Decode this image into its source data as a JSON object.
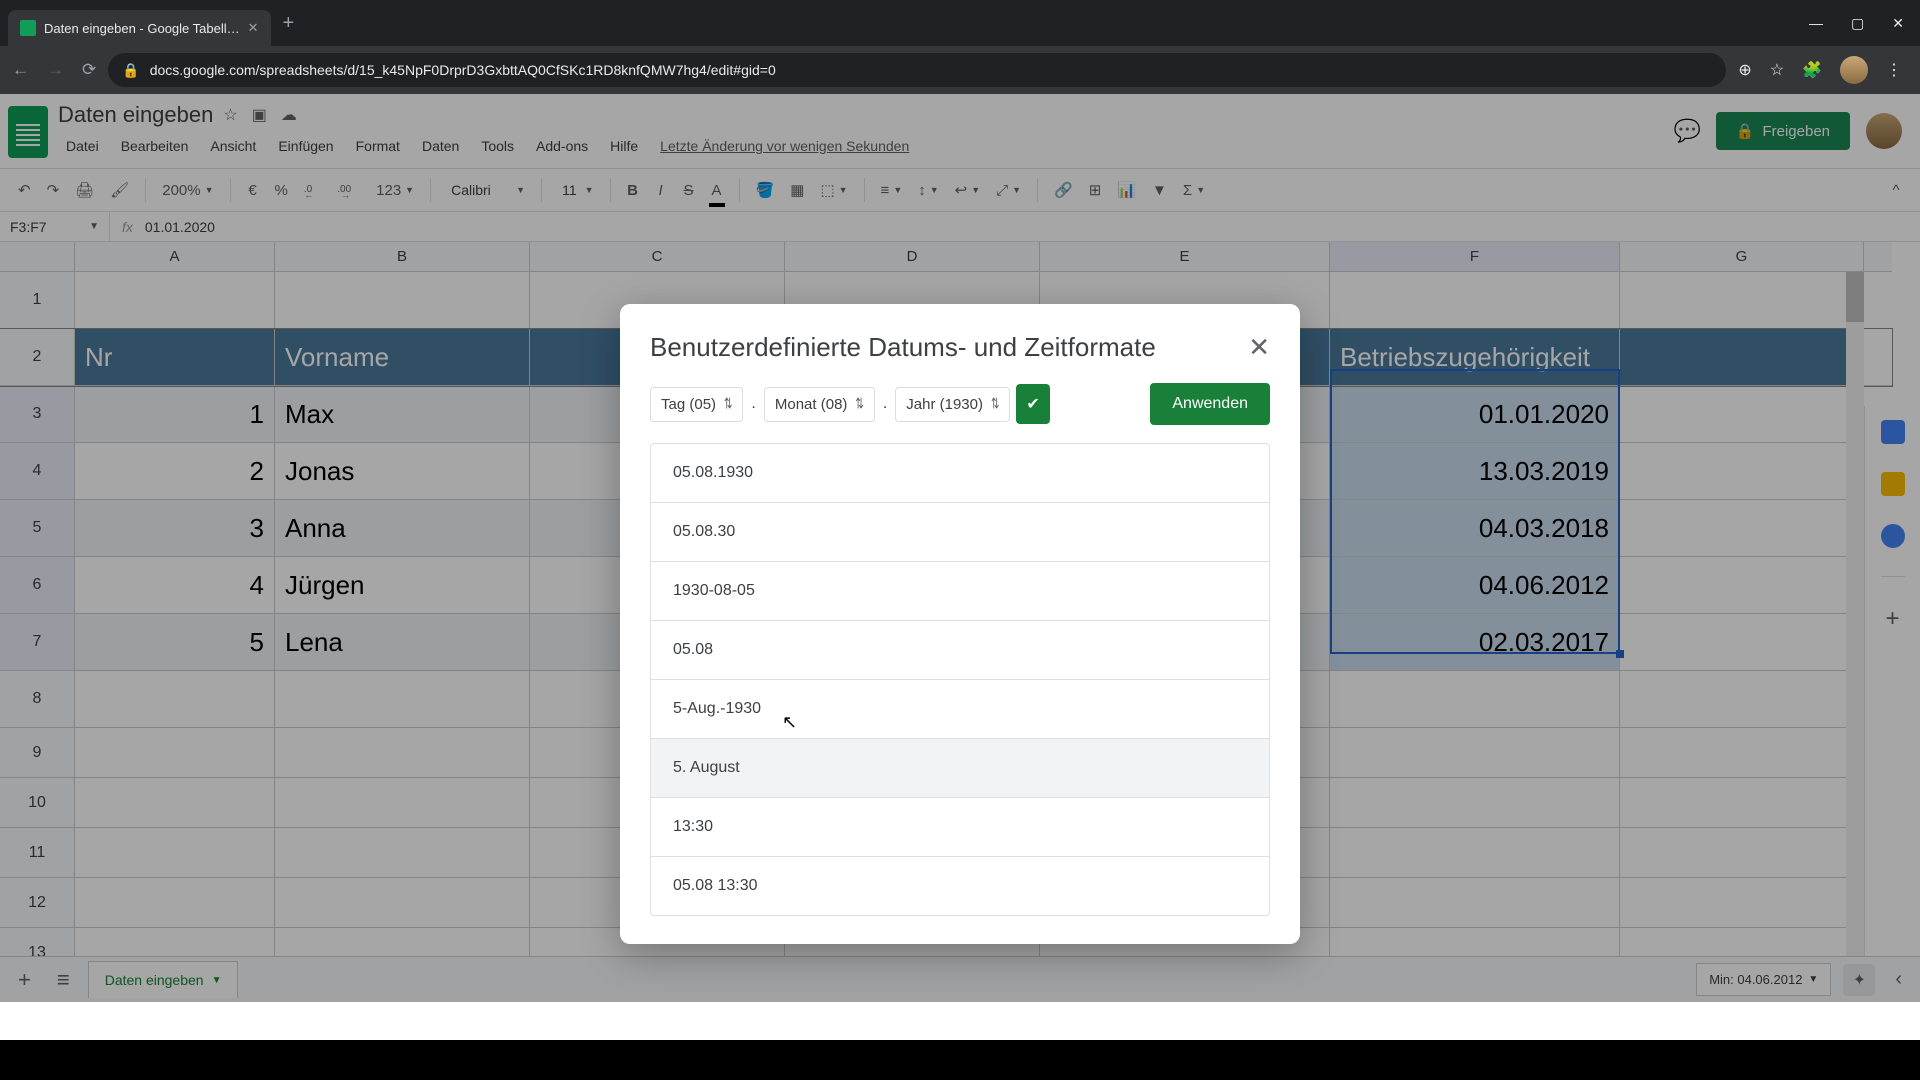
{
  "browser": {
    "tab_title": "Daten eingeben - Google Tabell…",
    "url": "docs.google.com/spreadsheets/d/15_k45NpF0DrprD3GxbttAQ0CfSKc1RD8knfQMW7hg4/edit#gid=0"
  },
  "doc": {
    "title": "Daten eingeben",
    "menus": [
      "Datei",
      "Bearbeiten",
      "Ansicht",
      "Einfügen",
      "Format",
      "Daten",
      "Tools",
      "Add-ons",
      "Hilfe"
    ],
    "last_edit": "Letzte Änderung vor wenigen Sekunden",
    "share_label": "Freigeben"
  },
  "toolbar": {
    "zoom": "200%",
    "currency": "€",
    "percent": "%",
    "dec_less": ".0",
    "dec_more": ".00",
    "number_fmt": "123",
    "font": "Calibri",
    "font_size": "11"
  },
  "formula_bar": {
    "name_box": "F3:F7",
    "fx": "fx",
    "value": "01.01.2020"
  },
  "columns": [
    "A",
    "B",
    "C",
    "D",
    "E",
    "F",
    "G"
  ],
  "header_row": {
    "A": "Nr",
    "B": "Vorname",
    "F": "Betriebszugehörigkeit"
  },
  "data_rows": [
    {
      "nr": "1",
      "name": "Max",
      "date": "01.01.2020"
    },
    {
      "nr": "2",
      "name": "Jonas",
      "date": "13.03.2019"
    },
    {
      "nr": "3",
      "name": "Anna",
      "date": "04.03.2018"
    },
    {
      "nr": "4",
      "name": "Jürgen",
      "date": "04.06.2012"
    },
    {
      "nr": "5",
      "name": "Lena",
      "date": "02.03.2017"
    }
  ],
  "dialog": {
    "title": "Benutzerdefinierte Datums- und Zeitformate",
    "chip_day": "Tag (05)",
    "chip_month": "Monat (08)",
    "chip_year": "Jahr (1930)",
    "apply": "Anwenden",
    "formats": [
      "05.08.1930",
      "05.08.30",
      "1930-08-05",
      "05.08",
      "5-Aug.-1930",
      "5. August",
      "13:30",
      "05.08 13:30"
    ]
  },
  "sheet_tabs": {
    "active": "Daten eingeben",
    "status": "Min: 04.06.2012"
  }
}
